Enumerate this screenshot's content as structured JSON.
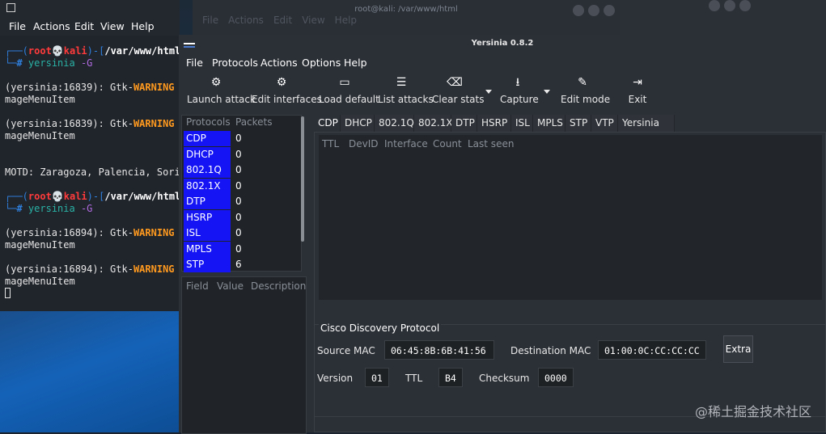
{
  "background_window": {
    "title": "root@kali: /var/www/html",
    "menu": [
      "File",
      "Actions",
      "Edit",
      "View",
      "Help"
    ]
  },
  "terminal": {
    "menu": [
      "File",
      "Actions",
      "Edit",
      "View",
      "Help"
    ],
    "lines": [
      {
        "type": "prompt",
        "user": "root",
        "host": "kali",
        "path": "/var/www/html"
      },
      {
        "type": "cmd",
        "cmd": "yersinia",
        "args": "-G"
      },
      {
        "type": "blank"
      },
      {
        "type": "warn",
        "pre": "(yersinia:16839): Gtk-",
        "warn": "WARNING",
        "post": " **"
      },
      {
        "type": "text",
        "text": "mageMenuItem"
      },
      {
        "type": "blank"
      },
      {
        "type": "warn",
        "pre": "(yersinia:16839): Gtk-",
        "warn": "WARNING",
        "post": " **"
      },
      {
        "type": "text",
        "text": "mageMenuItem"
      },
      {
        "type": "blank"
      },
      {
        "type": "blank"
      },
      {
        "type": "text",
        "text": "MOTD: Zaragoza, Palencia, Soria"
      },
      {
        "type": "blank"
      },
      {
        "type": "prompt",
        "user": "root",
        "host": "kali",
        "path": "/var/www/html"
      },
      {
        "type": "cmd",
        "cmd": "yersinia",
        "args": "-G"
      },
      {
        "type": "blank"
      },
      {
        "type": "warn",
        "pre": "(yersinia:16894): Gtk-",
        "warn": "WARNING",
        "post": " **"
      },
      {
        "type": "text",
        "text": "mageMenuItem"
      },
      {
        "type": "blank"
      },
      {
        "type": "warn",
        "pre": "(yersinia:16894): Gtk-",
        "warn": "WARNING",
        "post": " **"
      },
      {
        "type": "text",
        "text": "mageMenuItem"
      },
      {
        "type": "cursor"
      }
    ]
  },
  "yersinia": {
    "title": "Yersinia 0.8.2",
    "menu": [
      "File",
      "Protocols",
      "Actions",
      "Options",
      "Help"
    ],
    "toolbar": [
      {
        "label": "Launch attack",
        "icon": "launch-attack-icon"
      },
      {
        "label": "Edit interfaces",
        "icon": "edit-interfaces-icon"
      },
      {
        "label": "Load default",
        "icon": "load-default-icon"
      },
      {
        "label": "List attacks",
        "icon": "list-attacks-icon"
      },
      {
        "label": "Clear stats",
        "icon": "clear-stats-icon"
      },
      {
        "label": "Capture",
        "icon": "capture-icon"
      },
      {
        "label": "Edit mode",
        "icon": "edit-mode-icon"
      },
      {
        "label": "Exit",
        "icon": "exit-icon"
      }
    ],
    "protocols_headers": [
      "Protocols",
      "Packets"
    ],
    "protocols": [
      {
        "name": "CDP",
        "packets": "0"
      },
      {
        "name": "DHCP",
        "packets": "0"
      },
      {
        "name": "802.1Q",
        "packets": "0"
      },
      {
        "name": "802.1X",
        "packets": "0"
      },
      {
        "name": "DTP",
        "packets": "0"
      },
      {
        "name": "HSRP",
        "packets": "0"
      },
      {
        "name": "ISL",
        "packets": "0"
      },
      {
        "name": "MPLS",
        "packets": "0"
      },
      {
        "name": "STP",
        "packets": "6"
      }
    ],
    "field_headers": [
      "Field",
      "Value",
      "Description"
    ],
    "tabs": [
      "CDP",
      "DHCP",
      "802.1Q",
      "802.1X",
      "DTP",
      "HSRP",
      "ISL",
      "MPLS",
      "STP",
      "VTP",
      "Yersinia log"
    ],
    "active_tab": "CDP",
    "table_headers": [
      "TTL",
      "DevID",
      "Interface",
      "Count",
      "Last seen"
    ],
    "cdp": {
      "group_title": "Cisco Discovery Protocol",
      "source_mac_label": "Source MAC",
      "source_mac": "06:45:8B:6B:41:56",
      "dest_mac_label": "Destination MAC",
      "dest_mac": "01:00:0C:CC:CC:CC",
      "extra_label": "Extra",
      "version_label": "Version",
      "version": "01",
      "ttl_label": "TTL",
      "ttl": "B4",
      "checksum_label": "Checksum",
      "checksum": "0000"
    }
  },
  "watermark": "@稀土掘金技术社区",
  "colors": {
    "protocol_highlight": "#1414f5",
    "warning": "#ff9a1f",
    "prompt_user": "#ff3b3b",
    "path": "#2f7fdc"
  }
}
